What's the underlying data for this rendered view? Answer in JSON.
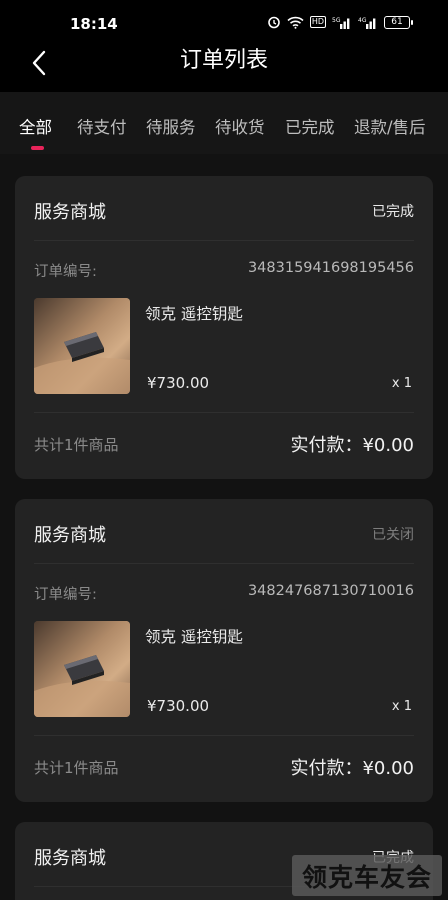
{
  "status_bar": {
    "time": "18:14",
    "hd": "HD",
    "battery": "61",
    "signal1": "5G",
    "signal2": "4G"
  },
  "nav": {
    "title": "订单列表"
  },
  "tabs": [
    {
      "label": "全部",
      "active": true
    },
    {
      "label": "待支付",
      "active": false
    },
    {
      "label": "待服务",
      "active": false
    },
    {
      "label": "待收货",
      "active": false
    },
    {
      "label": "已完成",
      "active": false
    },
    {
      "label": "退款/售后",
      "active": false
    }
  ],
  "orders": [
    {
      "shop": "服务商城",
      "status": "已完成",
      "status_color": "#e8e8e8",
      "order_label": "订单编号:",
      "order_no": "348315941698195456",
      "product_name": "领克 遥控钥匙",
      "price": "¥730.00",
      "qty": "x 1",
      "count_text": "共计1件商品",
      "pay_text": "实付款：¥0.00"
    },
    {
      "shop": "服务商城",
      "status": "已关闭",
      "status_color": "#7d7d7d",
      "order_label": "订单编号:",
      "order_no": "348247687130710016",
      "product_name": "领克 遥控钥匙",
      "price": "¥730.00",
      "qty": "x 1",
      "count_text": "共计1件商品",
      "pay_text": "实付款：¥0.00"
    },
    {
      "shop": "服务商城",
      "status": "已完成",
      "status_color": "#e8e8e8"
    }
  ],
  "watermark": "领克车友会",
  "colors": {
    "accent": "#e8245a",
    "card_bg": "#232323",
    "page_bg": "#121212"
  }
}
